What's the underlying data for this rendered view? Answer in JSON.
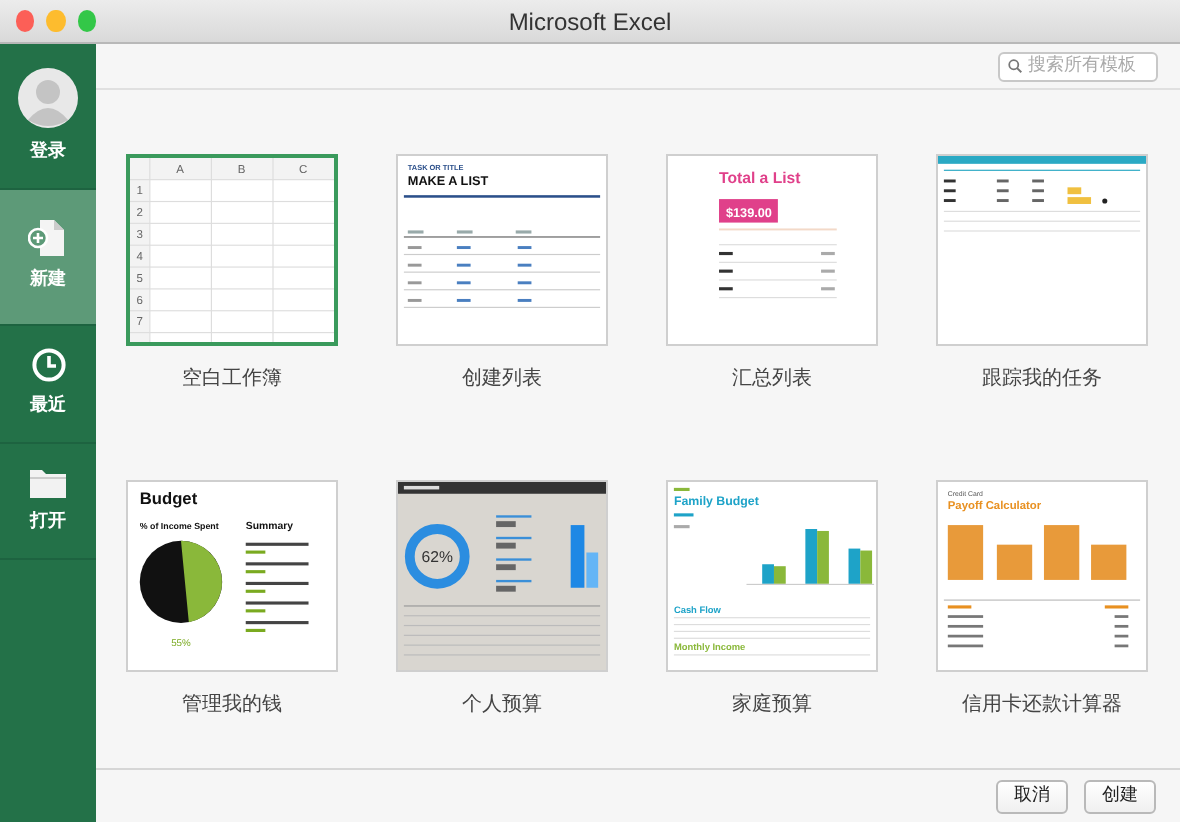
{
  "window": {
    "title": "Microsoft Excel"
  },
  "sidebar": {
    "items": [
      {
        "label": "登录",
        "selected": false
      },
      {
        "label": "新建",
        "selected": true
      },
      {
        "label": "最近",
        "selected": false
      },
      {
        "label": "打开",
        "selected": false
      }
    ]
  },
  "search": {
    "placeholder": "搜索所有模板"
  },
  "templates": [
    {
      "name": "空白工作簿",
      "selected": true,
      "preview": {
        "kind": "blank",
        "columns": [
          "A",
          "B",
          "C"
        ],
        "rows": [
          "1",
          "2",
          "3",
          "4",
          "5",
          "6",
          "7"
        ]
      }
    },
    {
      "name": "创建列表",
      "selected": false,
      "preview": {
        "kind": "list",
        "subtitle": "TASK OR TITLE",
        "title": "MAKE A LIST"
      }
    },
    {
      "name": "汇总列表",
      "selected": false,
      "preview": {
        "kind": "total",
        "title": "Total a List",
        "amount": "$139.00"
      }
    },
    {
      "name": "跟踪我的任务",
      "selected": false,
      "preview": {
        "kind": "tasks"
      }
    },
    {
      "name": "管理我的钱",
      "selected": false,
      "preview": {
        "kind": "budget",
        "title": "Budget",
        "subtitle": "% of Income Spent",
        "summary": "Summary",
        "percent": "55%"
      }
    },
    {
      "name": "个人预算",
      "selected": false,
      "preview": {
        "kind": "personal",
        "percent": "62%"
      }
    },
    {
      "name": "家庭预算",
      "selected": false,
      "preview": {
        "kind": "family",
        "title": "Family Budget",
        "sections": [
          "Cash Flow",
          "Monthly Income"
        ]
      }
    },
    {
      "name": "信用卡还款计算器",
      "selected": false,
      "preview": {
        "kind": "payoff",
        "subtitle": "Credit Card",
        "title": "Payoff Calculator"
      }
    }
  ],
  "buttons": [
    "取消",
    "创建"
  ]
}
